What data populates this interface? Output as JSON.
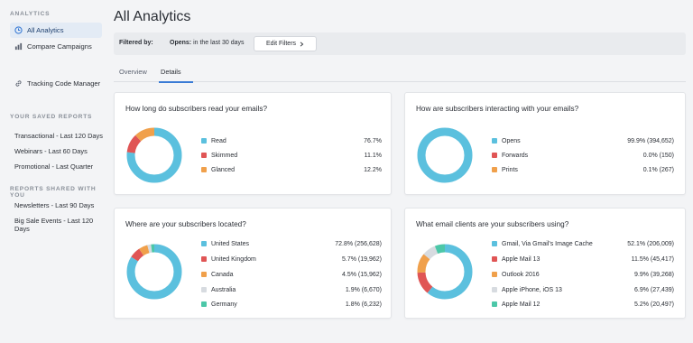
{
  "colors": {
    "blue": "#5bc0de",
    "red": "#e05555",
    "orange": "#f0a04b",
    "light": "#d7dbe0",
    "teal": "#4cc7a8",
    "accent": "#3a7bd5"
  },
  "sidebar": {
    "analytics_title": "ANALYTICS",
    "items": [
      {
        "label": "All Analytics",
        "icon": "clock-icon"
      },
      {
        "label": "Compare Campaigns",
        "icon": "bar-chart-icon"
      },
      {
        "label": "Tracking Code Manager",
        "icon": "link-icon"
      }
    ],
    "saved_title": "YOUR SAVED REPORTS",
    "saved_reports": [
      "Transactional - Last 120 Days",
      "Webinars - Last 60 Days",
      "Promotional - Last Quarter"
    ],
    "shared_title": "REPORTS SHARED WITH YOU",
    "shared_reports": [
      "Newsletters - Last 90 Days",
      "Big Sale Events - Last 120 Days"
    ]
  },
  "main": {
    "title": "All Analytics",
    "filter": {
      "label": "Filtered by:",
      "key": "Opens:",
      "value": "in the last 30 days",
      "button": "Edit Filters",
      "button_icon": "chevron-right-icon"
    },
    "tabs": [
      {
        "label": "Overview",
        "active": false
      },
      {
        "label": "Details",
        "active": true
      }
    ]
  },
  "cards": [
    {
      "title": "How long do subscribers read your emails?",
      "rows": [
        {
          "label": "Read",
          "value": "76.7%",
          "color": "#5bc0de",
          "pct": 76.7
        },
        {
          "label": "Skimmed",
          "value": "11.1%",
          "color": "#e05555",
          "pct": 11.1
        },
        {
          "label": "Glanced",
          "value": "12.2%",
          "color": "#f0a04b",
          "pct": 12.2
        }
      ]
    },
    {
      "title": "How are subscribers interacting with your emails?",
      "rows": [
        {
          "label": "Opens",
          "value": "99.9% (394,652)",
          "color": "#5bc0de",
          "pct": 99.9
        },
        {
          "label": "Forwards",
          "value": "0.0% (150)",
          "color": "#e05555",
          "pct": 0.0
        },
        {
          "label": "Prints",
          "value": "0.1% (267)",
          "color": "#f0a04b",
          "pct": 0.1
        }
      ]
    },
    {
      "title": "Where are your subscribers located?",
      "rows": [
        {
          "label": "United States",
          "value": "72.8% (256,628)",
          "color": "#5bc0de",
          "pct": 72.8
        },
        {
          "label": "United Kingdom",
          "value": "5.7% (19,962)",
          "color": "#e05555",
          "pct": 5.7
        },
        {
          "label": "Canada",
          "value": "4.5% (15,962)",
          "color": "#f0a04b",
          "pct": 4.5
        },
        {
          "label": "Australia",
          "value": "1.9% (6,670)",
          "color": "#d7dbe0",
          "pct": 1.9
        },
        {
          "label": "Germany",
          "value": "1.8% (6,232)",
          "color": "#4cc7a8",
          "pct": 1.8
        }
      ]
    },
    {
      "title": "What email clients are your subscribers using?",
      "rows": [
        {
          "label": "Gmail, Via Gmail's Image Cache",
          "value": "52.1% (206,009)",
          "color": "#5bc0de",
          "pct": 52.1
        },
        {
          "label": "Apple Mail 13",
          "value": "11.5% (45,417)",
          "color": "#e05555",
          "pct": 11.5
        },
        {
          "label": "Outlook 2016",
          "value": "9.9% (39,268)",
          "color": "#f0a04b",
          "pct": 9.9
        },
        {
          "label": "Apple iPhone, iOS 13",
          "value": "6.9% (27,439)",
          "color": "#d7dbe0",
          "pct": 6.9
        },
        {
          "label": "Apple Mail 12",
          "value": "5.2% (20,497)",
          "color": "#4cc7a8",
          "pct": 5.2
        }
      ]
    }
  ]
}
